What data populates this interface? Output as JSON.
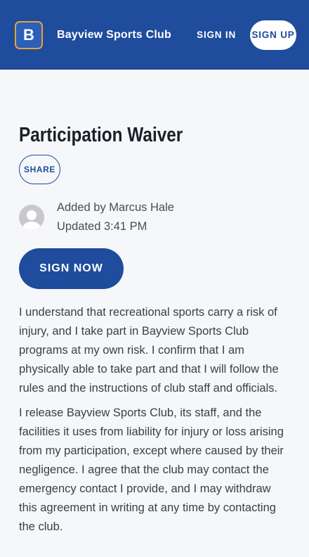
{
  "header": {
    "logo_letter": "B",
    "brand": "Bayview Sports Club",
    "sign_in": "SIGN IN",
    "sign_up": "SIGN UP"
  },
  "document": {
    "title": "Participation Waiver",
    "share": "SHARE",
    "added_by": "Added by Marcus Hale",
    "updated": "Updated 3:41 PM",
    "sign_now": "SIGN NOW",
    "paragraphs": [
      "I understand that recreational sports carry a risk of injury, and I take part in Bayview Sports Club programs at my own risk. I confirm that I am physically able to take part and that I will follow the rules and the instructions of club staff and officials.",
      "I release Bayview Sports Club, its staff, and the facilities it uses from liability for injury or loss arising from my participation, except where caused by their negligence. I agree that the club may contact the emergency contact I provide, and I may withdraw this agreement in writing at any time by contacting the club."
    ]
  },
  "colors": {
    "brand_blue": "#1f4c9c",
    "logo_border": "#e8a23a",
    "background": "#f5f7fa"
  },
  "icons": {
    "avatar": "user-avatar-placeholder-icon"
  }
}
